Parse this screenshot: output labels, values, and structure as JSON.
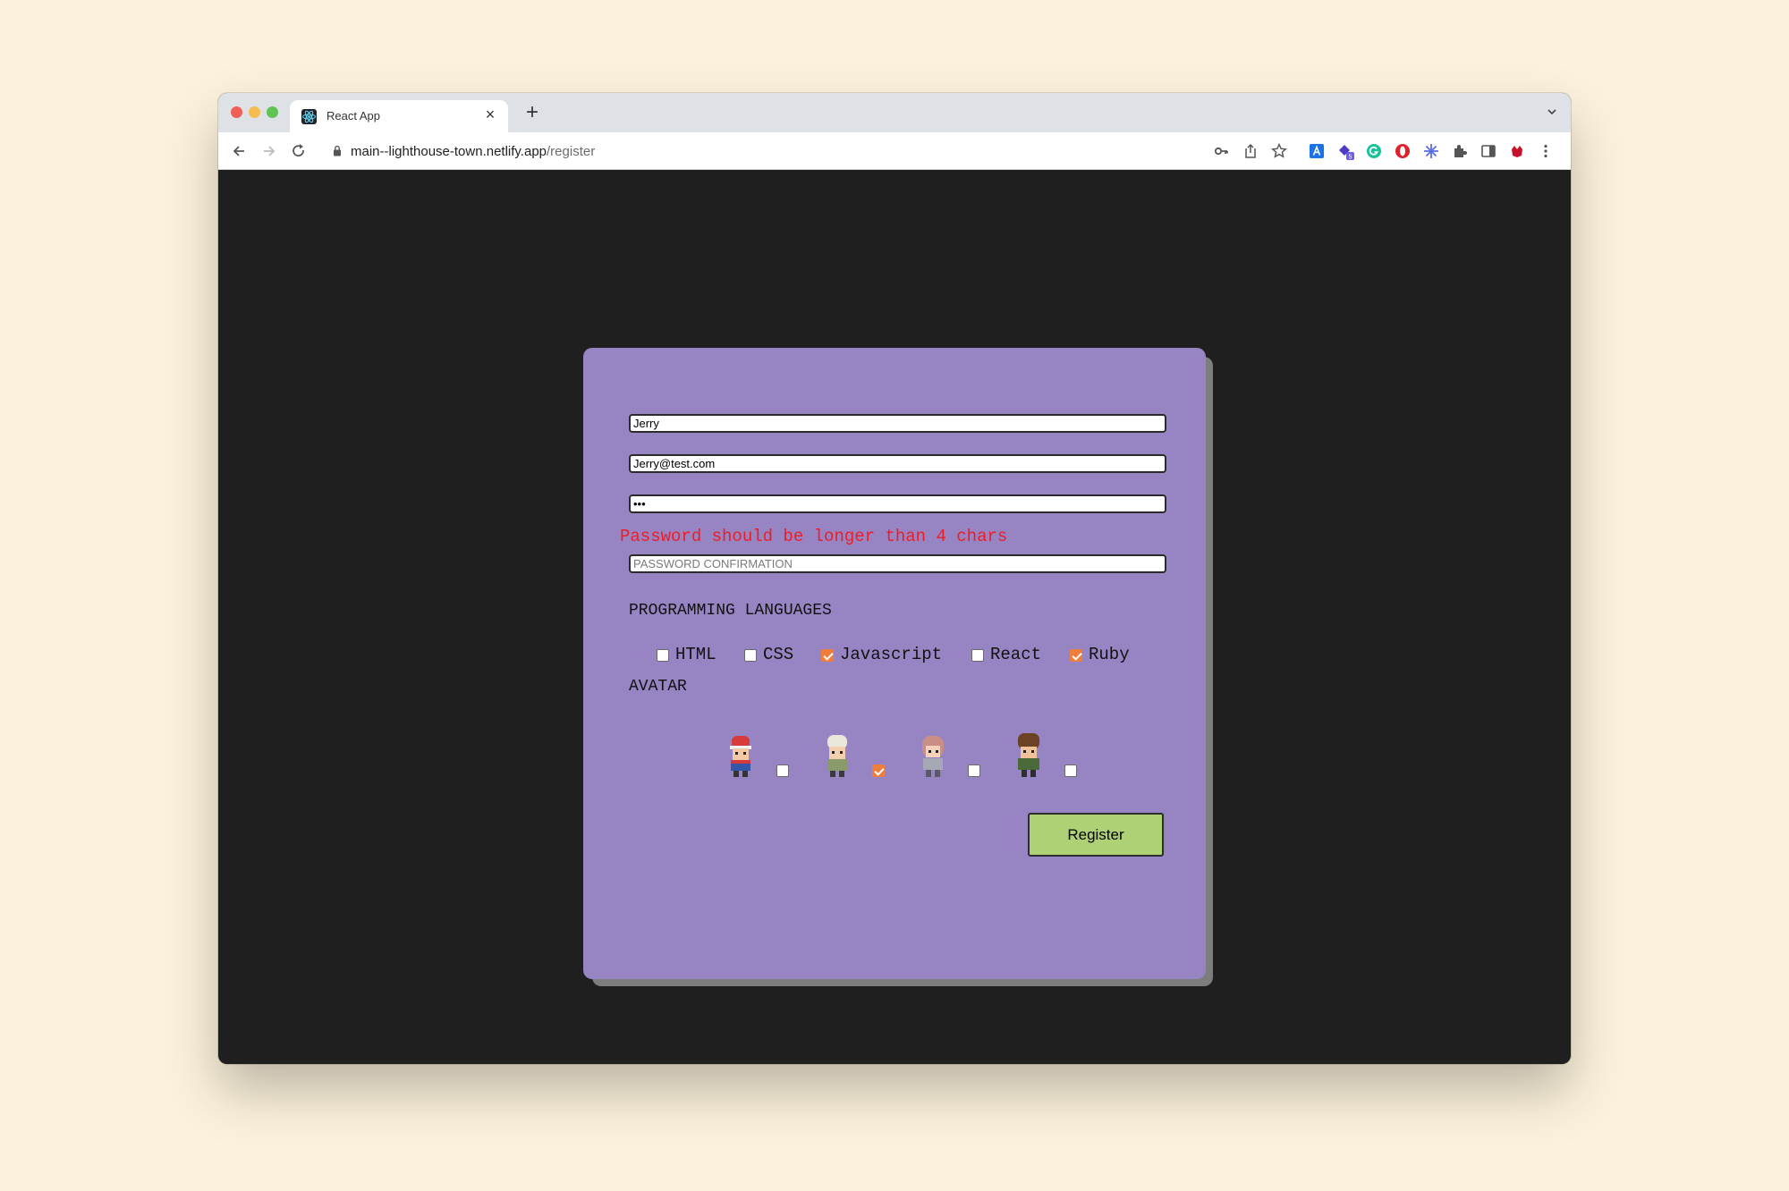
{
  "browser": {
    "tab_title": "React App",
    "url_host": "main--lighthouse-town.netlify.app",
    "url_path": "/register"
  },
  "form": {
    "name_value": "Jerry",
    "email_value": "Jerry@test.com",
    "password_value": "•••",
    "password_error": "Password should be longer than 4 chars",
    "password_confirmation_placeholder": "PASSWORD CONFIRMATION",
    "languages_heading": "PROGRAMMING LANGUAGES",
    "languages": [
      {
        "label": "HTML",
        "checked": false
      },
      {
        "label": "CSS",
        "checked": false
      },
      {
        "label": "Javascript",
        "checked": true
      },
      {
        "label": "React",
        "checked": false
      },
      {
        "label": "Ruby",
        "checked": true
      }
    ],
    "avatar_heading": "AVATAR",
    "avatars": [
      {
        "name": "red-cap-trainer",
        "checked": false
      },
      {
        "name": "white-hair-trainer",
        "checked": true
      },
      {
        "name": "pink-hair-trainer",
        "checked": false
      },
      {
        "name": "brown-hair-trainer",
        "checked": false
      }
    ],
    "register_label": "Register"
  },
  "colors": {
    "page_bg": "#fcf2dc",
    "app_bg": "#1f1f1f",
    "card_bg": "#9785c3",
    "error": "#ee1c25",
    "checkbox_checked": "#ef7d3c",
    "register_bg": "#afd176"
  }
}
